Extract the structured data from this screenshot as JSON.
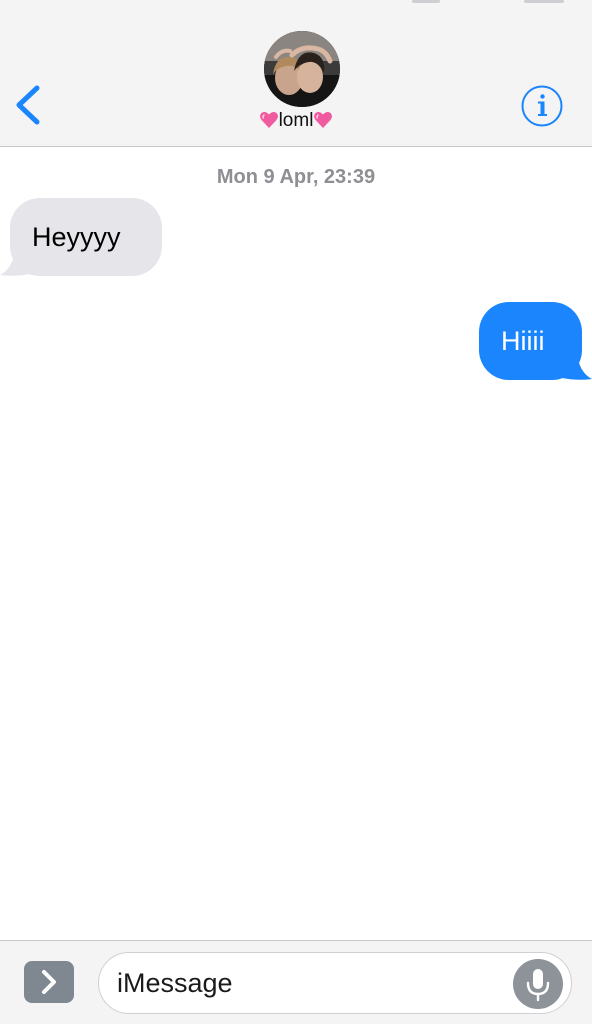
{
  "app": "Messages",
  "header": {
    "back_icon": "chevron-left-icon",
    "contact_name": "💗loml💗",
    "contact_name_prefix_emoji": "💗",
    "contact_name_text": "loml",
    "contact_name_suffix_emoji": "💗",
    "avatar_icon": "contact-photo",
    "info_icon": "info-icon"
  },
  "conversation": {
    "timestamp": "Mon 9 Apr, 23:39",
    "messages": [
      {
        "direction": "received",
        "text": "Heyyyy"
      },
      {
        "direction": "sent",
        "text": "Hiiii"
      }
    ]
  },
  "composer": {
    "apps_icon": "chevron-right-icon",
    "placeholder": "iMessage",
    "mic_icon": "microphone-icon"
  },
  "colors": {
    "accent": "#1a85fc",
    "received_bubble": "#e5e5ea",
    "header_bg": "#f4f4f5",
    "timestamp": "#8e8e93"
  }
}
